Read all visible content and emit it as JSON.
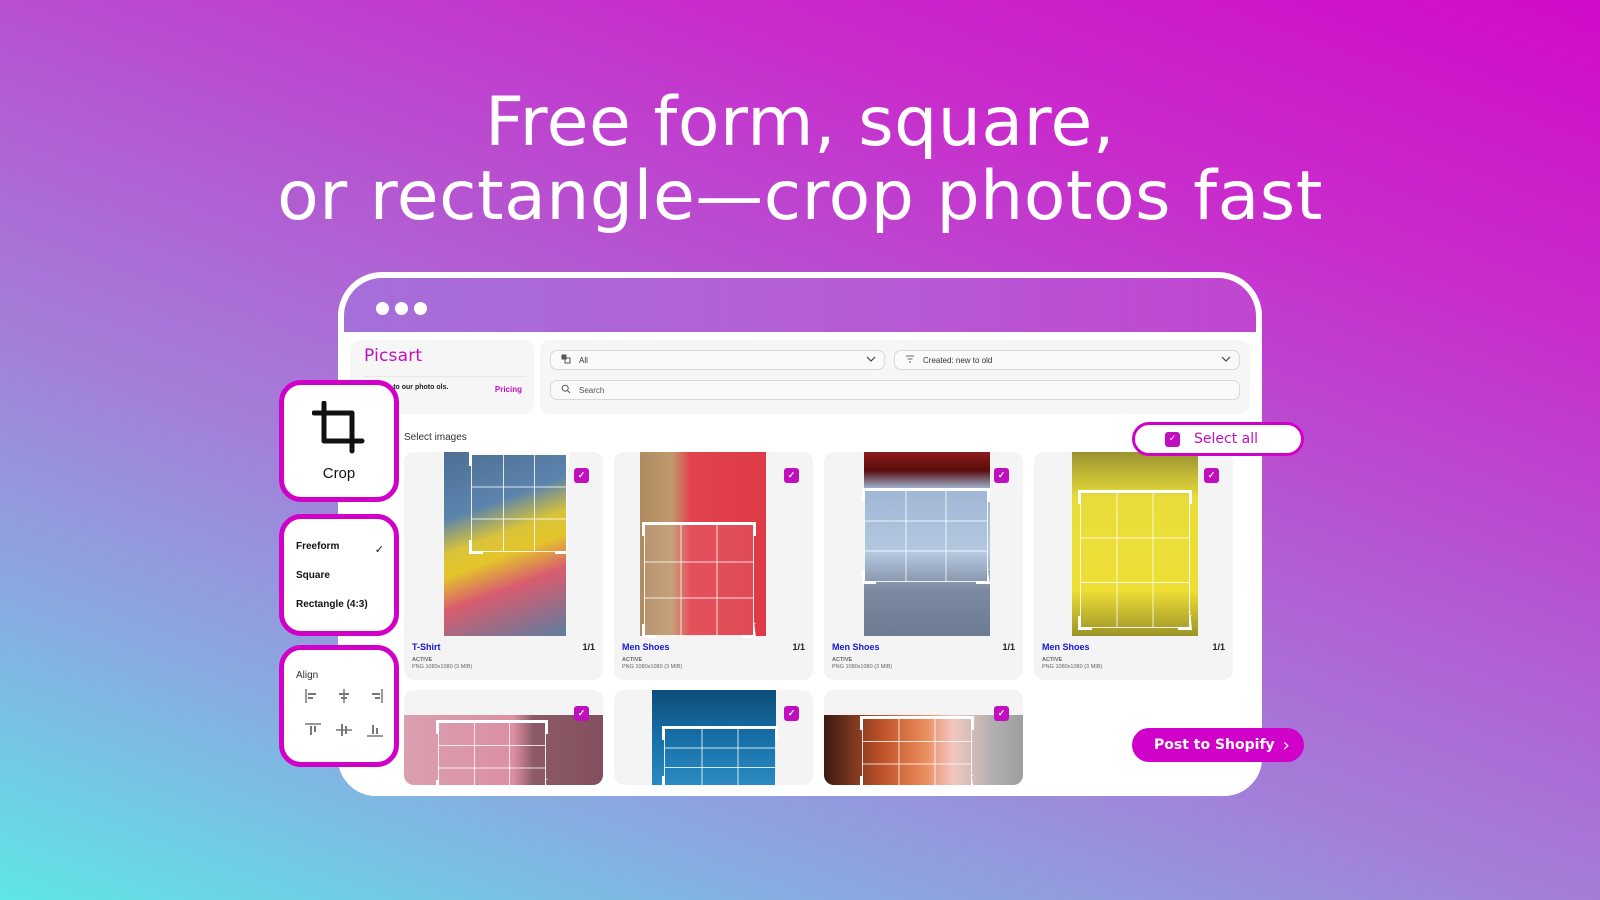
{
  "headline": {
    "line1": "Free form, square,",
    "line2": "or rectangle—crop photos fast"
  },
  "browser": {
    "dots_icon": "window-dots-icon"
  },
  "app": {
    "brand": {
      "logo": "Picsart",
      "promo_text": "l access to our photo ols.",
      "pricing_link": "Pricing"
    },
    "filters": {
      "type_select": {
        "value": "All",
        "icon": "gallery-icon"
      },
      "sort_select": {
        "value": "Created: new to old",
        "icon": "filter-icon"
      },
      "search": {
        "placeholder": "Search",
        "icon": "search-icon"
      }
    },
    "select_images_label": "Select images",
    "select_all_label": "Select all",
    "post_button_label": "Post to Shopify",
    "products": [
      {
        "name": "T-Shirt",
        "count": "1/1",
        "status": "ACTIVE",
        "meta": "PNG 1080x1080 (3 MIB)",
        "selected": true
      },
      {
        "name": "Men Shoes",
        "count": "1/1",
        "status": "ACTIVE",
        "meta": "PNG 1080x1080 (3 MIB)",
        "selected": true
      },
      {
        "name": "Men Shoes",
        "count": "1/1",
        "status": "ACTIVE",
        "meta": "PNG 1080x1080 (3 MIB)",
        "selected": true
      },
      {
        "name": "Men Shoes",
        "count": "1/1",
        "status": "ACTIVE",
        "meta": "PNG 1080x1080 (3 MIB)",
        "selected": true
      },
      {
        "selected": true
      },
      {
        "selected": true
      },
      {
        "selected": true
      }
    ]
  },
  "tools": {
    "crop": {
      "label": "Crop",
      "icon": "crop-icon"
    },
    "modes": [
      {
        "label": "Freeform",
        "selected": true
      },
      {
        "label": "Square",
        "selected": false
      },
      {
        "label": "Rectangle (4:3)",
        "selected": false
      }
    ],
    "align": {
      "title": "Align",
      "icons": [
        "align-left-icon",
        "align-center-h-icon",
        "align-right-icon",
        "align-top-icon",
        "align-middle-v-icon",
        "align-bottom-icon"
      ]
    }
  },
  "colors": {
    "brand": "#d100c8",
    "link": "#1417d6"
  }
}
